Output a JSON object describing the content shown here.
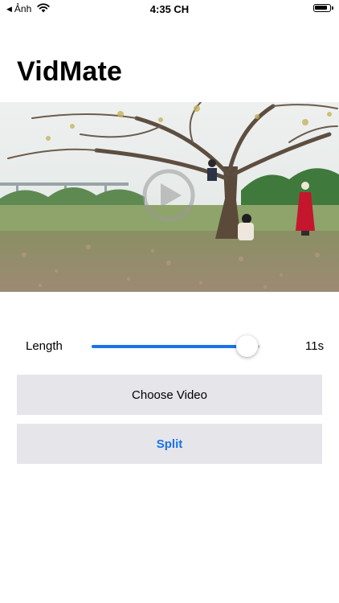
{
  "status_bar": {
    "back_label": "Ảnh",
    "time": "4:35 CH"
  },
  "app": {
    "title": "VidMate"
  },
  "video": {
    "play_icon": "play-circle-icon"
  },
  "length": {
    "label": "Length",
    "value_text": "11s",
    "slider_fraction": 0.92
  },
  "buttons": {
    "choose_label": "Choose Video",
    "split_label": "Split"
  },
  "colors": {
    "accent": "#1a73e8",
    "button_bg": "#e5e5ea"
  }
}
